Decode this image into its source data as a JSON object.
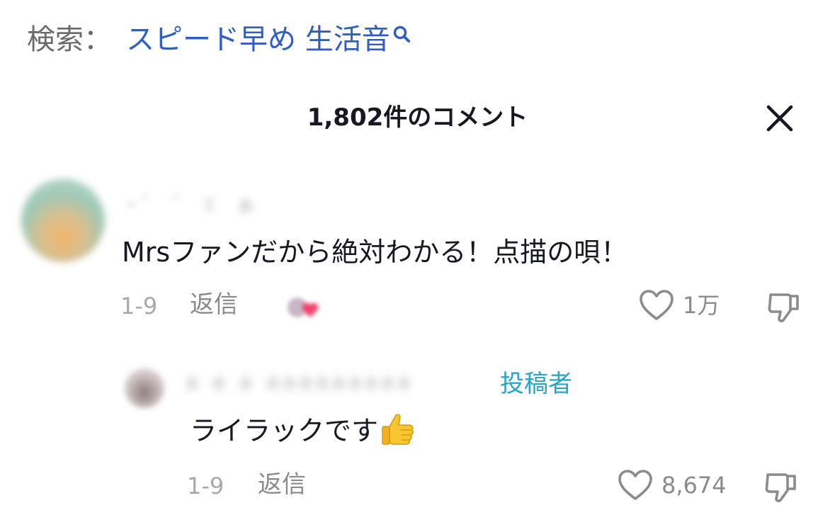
{
  "search": {
    "label": "検索：",
    "query": "スピード早め 生活音",
    "link_color": "#2f5fc4"
  },
  "header": {
    "title": "1,802件のコメント",
    "close_icon": "close-icon"
  },
  "comments": [
    {
      "username": "・ﾞ_゛ゞ ぁ",
      "text": "Mrsファンだから絶対わかる！点描の唄！",
      "date": "1-9",
      "reply_label": "返信",
      "liked_by_creator": true,
      "likes": "1万"
    }
  ],
  "reply": {
    "username": "a a a aaaaaaaaa",
    "author_badge": "投稿者",
    "author_badge_color": "#25a6c9",
    "text": "ライラックです",
    "emoji": "thumbs-up-emoji",
    "date": "1-9",
    "reply_label": "返信",
    "likes": "8,674"
  }
}
